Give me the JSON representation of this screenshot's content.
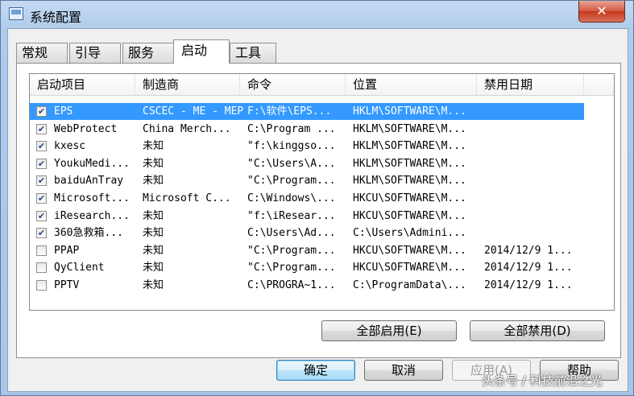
{
  "window": {
    "title": "系统配置",
    "close_glyph": "✕"
  },
  "tabs": [
    {
      "label": "常规"
    },
    {
      "label": "引导"
    },
    {
      "label": "服务"
    },
    {
      "label": "启动"
    },
    {
      "label": "工具"
    }
  ],
  "columns": [
    "启动项目",
    "制造商",
    "命令",
    "位置",
    "禁用日期"
  ],
  "rows": [
    {
      "checked": true,
      "selected": true,
      "item": "EPS",
      "maker": "CSCEC - ME - MEP",
      "command": "F:\\软件\\EPS...",
      "location": "HKLM\\SOFTWARE\\M...",
      "date": ""
    },
    {
      "checked": true,
      "selected": false,
      "item": "WebProtect",
      "maker": "China Merch...",
      "command": "C:\\Program ...",
      "location": "HKLM\\SOFTWARE\\M...",
      "date": ""
    },
    {
      "checked": true,
      "selected": false,
      "item": "kxesc",
      "maker": "未知",
      "command": "\"f:\\kinggso...",
      "location": "HKLM\\SOFTWARE\\M...",
      "date": ""
    },
    {
      "checked": true,
      "selected": false,
      "item": "YoukuMedi...",
      "maker": "未知",
      "command": "\"C:\\Users\\A...",
      "location": "HKLM\\SOFTWARE\\M...",
      "date": ""
    },
    {
      "checked": true,
      "selected": false,
      "item": "baiduAnTray",
      "maker": "未知",
      "command": "\"C:\\Program...",
      "location": "HKLM\\SOFTWARE\\M...",
      "date": ""
    },
    {
      "checked": true,
      "selected": false,
      "item": "Microsoft...",
      "maker": "Microsoft C...",
      "command": "C:\\Windows\\...",
      "location": "HKCU\\SOFTWARE\\M...",
      "date": ""
    },
    {
      "checked": true,
      "selected": false,
      "item": "iResearch...",
      "maker": "未知",
      "command": "\"f:\\iResear...",
      "location": "HKCU\\SOFTWARE\\M...",
      "date": ""
    },
    {
      "checked": true,
      "selected": false,
      "item": "360急救箱...",
      "maker": "未知",
      "command": "C:\\Users\\Ad...",
      "location": "C:\\Users\\Admini...",
      "date": ""
    },
    {
      "checked": false,
      "selected": false,
      "item": "PPAP",
      "maker": "未知",
      "command": "\"C:\\Program...",
      "location": "HKCU\\SOFTWARE\\M...",
      "date": "2014/12/9 1..."
    },
    {
      "checked": false,
      "selected": false,
      "item": "QyClient",
      "maker": "未知",
      "command": "\"C:\\Program...",
      "location": "HKCU\\SOFTWARE\\M...",
      "date": "2014/12/9 1..."
    },
    {
      "checked": false,
      "selected": false,
      "item": "PPTV",
      "maker": "未知",
      "command": "C:\\PROGRA~1...",
      "location": "C:\\ProgramData\\...",
      "date": "2014/12/9 1..."
    }
  ],
  "buttons": {
    "enable_all": "全部启用(E)",
    "disable_all": "全部禁用(D)",
    "ok": "确定",
    "cancel": "取消",
    "apply": "应用(A)",
    "help": "帮助"
  },
  "watermark": "头条号 / 科技前沿之光"
}
